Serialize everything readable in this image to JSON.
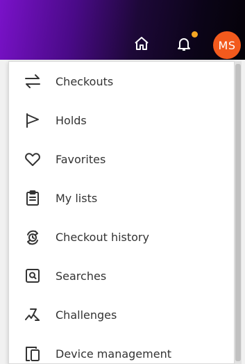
{
  "header": {
    "avatar_initials": "MS",
    "notification_dot_color": "#f5a623",
    "avatar_color": "#f25a1d"
  },
  "icons": {
    "home": "home-icon",
    "bell": "bell-icon"
  },
  "menu": {
    "items": [
      {
        "label": "Checkouts",
        "icon": "swap-arrows-icon"
      },
      {
        "label": "Holds",
        "icon": "flag-icon"
      },
      {
        "label": "Favorites",
        "icon": "heart-icon"
      },
      {
        "label": "My lists",
        "icon": "clipboard-icon"
      },
      {
        "label": "Checkout history",
        "icon": "history-icon"
      },
      {
        "label": "Searches",
        "icon": "saved-search-icon"
      },
      {
        "label": "Challenges",
        "icon": "challenge-icon"
      },
      {
        "label": "Device management",
        "icon": "device-icon"
      }
    ]
  }
}
